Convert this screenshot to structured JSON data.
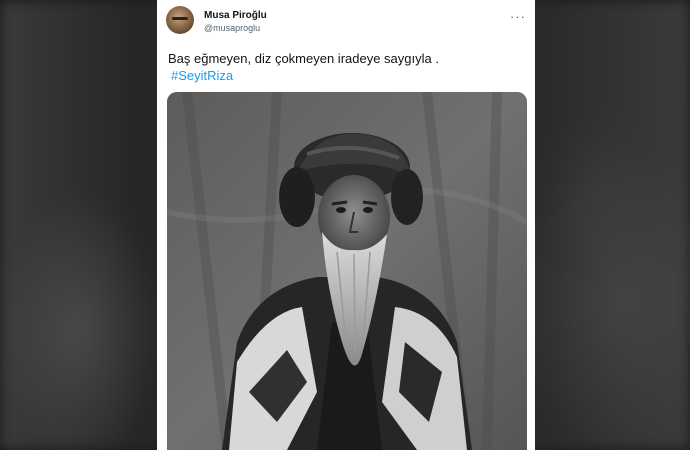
{
  "tweet": {
    "author_name": "Musa Piroğlu",
    "author_handle": "@musaproglu",
    "text": "Baş eğmeyen, diz çokmeyen iradeye saygıyla .",
    "hashtag": "#SeyitRiza",
    "more_glyph": "···",
    "image_subject": "black-and-white portrait of a bearded elderly man in turban"
  },
  "icons": {
    "more": "more-horizontal-icon",
    "avatar": "user-avatar"
  },
  "colors": {
    "link": "#1d9bf0",
    "text": "#0f1419",
    "secondary": "#536471",
    "card": "#ffffff"
  }
}
